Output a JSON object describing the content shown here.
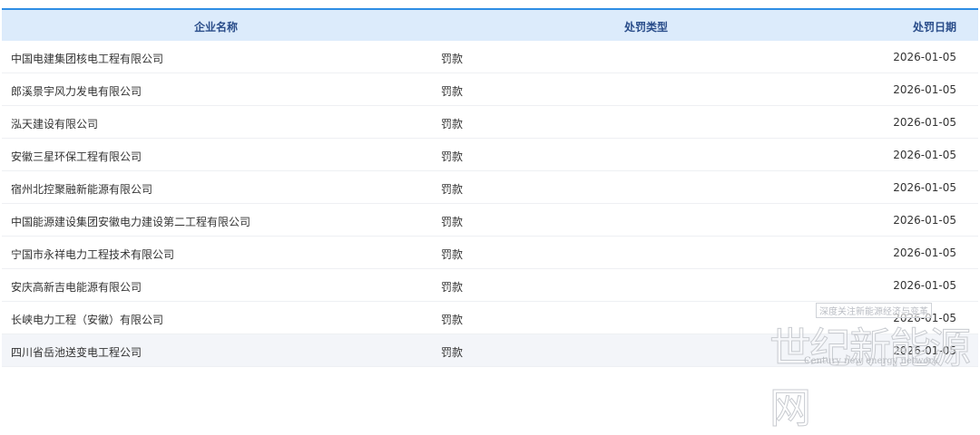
{
  "table": {
    "headers": {
      "name": "企业名称",
      "type": "处罚类型",
      "date": "处罚日期"
    },
    "rows": [
      {
        "name": "中国电建集团核电工程有限公司",
        "type": "罚款",
        "date": "2026-01-05"
      },
      {
        "name": "郎溪景宇风力发电有限公司",
        "type": "罚款",
        "date": "2026-01-05"
      },
      {
        "name": "泓天建设有限公司",
        "type": "罚款",
        "date": "2026-01-05"
      },
      {
        "name": "安徽三星环保工程有限公司",
        "type": "罚款",
        "date": "2026-01-05"
      },
      {
        "name": "宿州北控聚融新能源有限公司",
        "type": "罚款",
        "date": "2026-01-05"
      },
      {
        "name": "中国能源建设集团安徽电力建设第二工程有限公司",
        "type": "罚款",
        "date": "2026-01-05"
      },
      {
        "name": "宁国市永祥电力工程技术有限公司",
        "type": "罚款",
        "date": "2026-01-05"
      },
      {
        "name": "安庆高新吉电能源有限公司",
        "type": "罚款",
        "date": "2026-01-05"
      },
      {
        "name": "长峡电力工程（安徽）有限公司",
        "type": "罚款",
        "date": "2026-01-05"
      },
      {
        "name": "四川省岳池送变电工程公司",
        "type": "罚款",
        "date": "2026-01-05"
      }
    ]
  },
  "watermark": {
    "tagline": "深度关注新能源经济与变革",
    "name": "世纪新能源网",
    "english": "Century new energy network"
  },
  "colors": {
    "accent": "#2f8de4",
    "header_bg": "#dcebfb",
    "header_text": "#2a4d8a"
  }
}
